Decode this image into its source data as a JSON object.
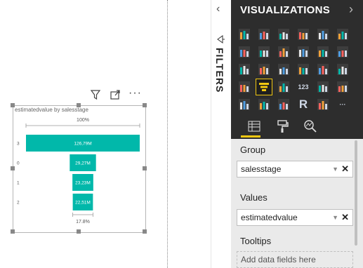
{
  "filters_pane": {
    "collapse_label": "‹",
    "title": "FILTERS"
  },
  "visualizations_pane": {
    "title": "VISUALIZATIONS",
    "expand_label": "›",
    "tiles": [
      {
        "icon": "stacked-bar-chart-icon"
      },
      {
        "icon": "stacked-column-chart-icon"
      },
      {
        "icon": "clustered-bar-chart-icon"
      },
      {
        "icon": "clustered-column-chart-icon"
      },
      {
        "icon": "100-stacked-bar-chart-icon"
      },
      {
        "icon": "100-stacked-column-chart-icon"
      },
      {
        "icon": "line-chart-icon"
      },
      {
        "icon": "area-chart-icon"
      },
      {
        "icon": "stacked-area-chart-icon"
      },
      {
        "icon": "line-and-column-chart-icon"
      },
      {
        "icon": "line-and-stacked-column-chart-icon"
      },
      {
        "icon": "ribbon-chart-icon"
      },
      {
        "icon": "waterfall-chart-icon"
      },
      {
        "icon": "scatter-chart-icon"
      },
      {
        "icon": "pie-chart-icon"
      },
      {
        "icon": "donut-chart-icon"
      },
      {
        "icon": "treemap-icon"
      },
      {
        "icon": "map-icon"
      },
      {
        "icon": "filled-map-icon"
      },
      {
        "icon": "funnel-icon",
        "selected": true
      },
      {
        "icon": "gauge-icon"
      },
      {
        "icon": "card-icon",
        "text": "123"
      },
      {
        "icon": "multi-row-card-icon"
      },
      {
        "icon": "kpi-icon"
      },
      {
        "icon": "slicer-icon"
      },
      {
        "icon": "table-icon"
      },
      {
        "icon": "matrix-icon"
      },
      {
        "icon": "r-script-icon",
        "text": "R"
      },
      {
        "icon": "globe-icon"
      },
      {
        "icon": "more-icon",
        "text": "···"
      }
    ],
    "tabs": [
      {
        "icon": "fields-tab-icon"
      },
      {
        "icon": "format-paint-roller-icon"
      },
      {
        "icon": "analytics-magnifier-icon"
      }
    ],
    "wells": {
      "group_label": "Group",
      "group_value": "salesstage",
      "values_label": "Values",
      "values_value": "estimatedvalue",
      "tooltips_label": "Tooltips",
      "tooltips_placeholder": "Add data fields here"
    }
  },
  "visual": {
    "title": "estimatedvalue by salesstage",
    "header_icons": [
      "filter-icon",
      "focus-mode-icon",
      "more-options-icon"
    ],
    "top_label": "100%",
    "bottom_label": "17.8%"
  },
  "chart_data": {
    "type": "funnel",
    "title": "estimatedvalue by salesstage",
    "categories": [
      "3",
      "0",
      "1",
      "2"
    ],
    "values": [
      126.79,
      29.27,
      23.23,
      22.51
    ],
    "labels": [
      "126,79M",
      "29,27M",
      "23,23M",
      "22,51M"
    ],
    "unit": "M",
    "first_percent": "100%",
    "last_percent": "17.8%",
    "color": "#01b8aa"
  }
}
